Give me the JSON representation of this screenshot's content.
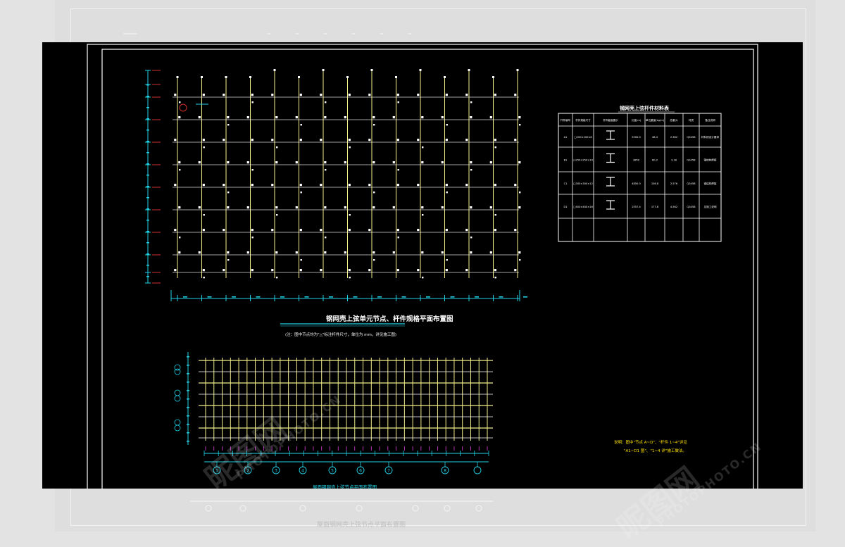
{
  "drawing": {
    "colors": {
      "background": "#000000",
      "grid_yellow": "#f4f08a",
      "grid_white": "#ffffff",
      "dimension_cyan": "#22d3e6",
      "axis_red": "#d03030",
      "table_line": "#ffffff",
      "note_yellow": "#ffe000",
      "tick_magenta": "#e040e0"
    },
    "plan1": {
      "title": "钢网壳上弦单元节点、杆件规格平面布置图",
      "note": "(注：图中节点均为\"△\"标注杆件尺寸，单位为 mm，详见施工图)",
      "columns": 15,
      "rows": 9
    },
    "table": {
      "title": "钢网壳上弦杆件材料表",
      "headers": [
        "杆件编号",
        "杆件规格尺寸",
        "杆件截面图示",
        "长度(m)",
        "单位重量(kg/m)",
        "总重(t)",
        "材质",
        "备注说明"
      ],
      "rows": [
        {
          "id": "A1",
          "spec": "□200×200×8",
          "len": "5500.0",
          "w": "48.4",
          "t": "2.362",
          "mat": "Q345B",
          "note": "材料按设计要求"
        },
        {
          "id": "B1",
          "spec": "□250×250×10",
          "len": "3850",
          "w": "80.2",
          "t": "3.18",
          "mat": "Q345B",
          "note": "钢结构焊接"
        },
        {
          "id": "C1",
          "spec": "□300×300×12",
          "len": "4850.0",
          "w": "108.8",
          "t": "2.576",
          "mat": "Q345B",
          "note": "钢结构焊接"
        },
        {
          "id": "D1",
          "spec": "□400×400×16",
          "len": "2557.4",
          "w": "177.8",
          "t": "4.562",
          "mat": "Q345B",
          "note": "见施工说明"
        }
      ]
    },
    "plan2": {
      "title": "屋面钢网壳上弦节点平面布置图",
      "axis_labels": [
        "1",
        "2",
        "3",
        "4",
        "5",
        "6",
        "7",
        "8"
      ]
    },
    "notes": {
      "line1": "说明：图中\"节点 A~D\"、\"杆件 1~4\"详见",
      "line2": "\"A1~D1 图\"、\"1~4 详\"施工做法。"
    }
  },
  "watermark": {
    "cn": "昵图网",
    "en": "PHOTOPHOTO.CN"
  }
}
